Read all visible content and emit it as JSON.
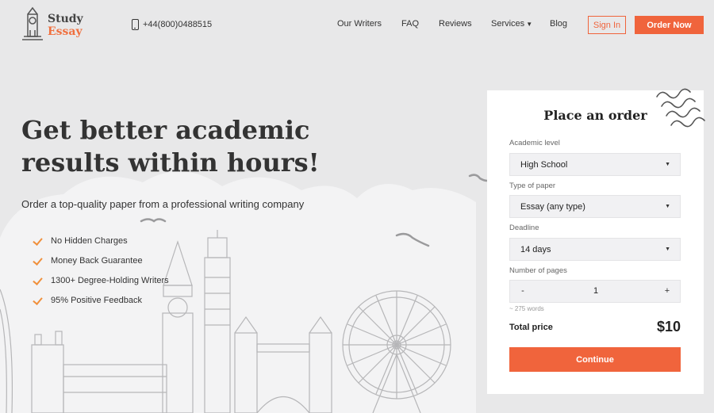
{
  "header": {
    "logo": {
      "line1": "Study",
      "line2": "Essay"
    },
    "phone": "+44(800)0488515",
    "nav": [
      {
        "label": "Our Writers"
      },
      {
        "label": "FAQ"
      },
      {
        "label": "Reviews"
      },
      {
        "label": "Services"
      },
      {
        "label": "Blog"
      }
    ],
    "sign_in": "Sign In",
    "order_now": "Order Now"
  },
  "hero": {
    "title": "Get better academic results within hours!",
    "subtitle": "Order a top-quality paper from a professional writing company",
    "features": [
      "No Hidden Charges",
      "Money Back Guarantee",
      "1300+ Degree-Holding Writers",
      "95% Positive Feedback"
    ]
  },
  "order_form": {
    "title": "Place an order",
    "academic_level": {
      "label": "Academic level",
      "value": "High School"
    },
    "paper_type": {
      "label": "Type of paper",
      "value": "Essay (any type)"
    },
    "deadline": {
      "label": "Deadline",
      "value": "14 days"
    },
    "pages": {
      "label": "Number of pages",
      "minus": "-",
      "value": "1",
      "plus": "+",
      "words": "~ 275 words"
    },
    "total_label": "Total price",
    "total_price": "$10",
    "continue": "Continue"
  },
  "colors": {
    "accent": "#f0643c",
    "check": "#f0903c",
    "background": "#e8e8e9"
  }
}
